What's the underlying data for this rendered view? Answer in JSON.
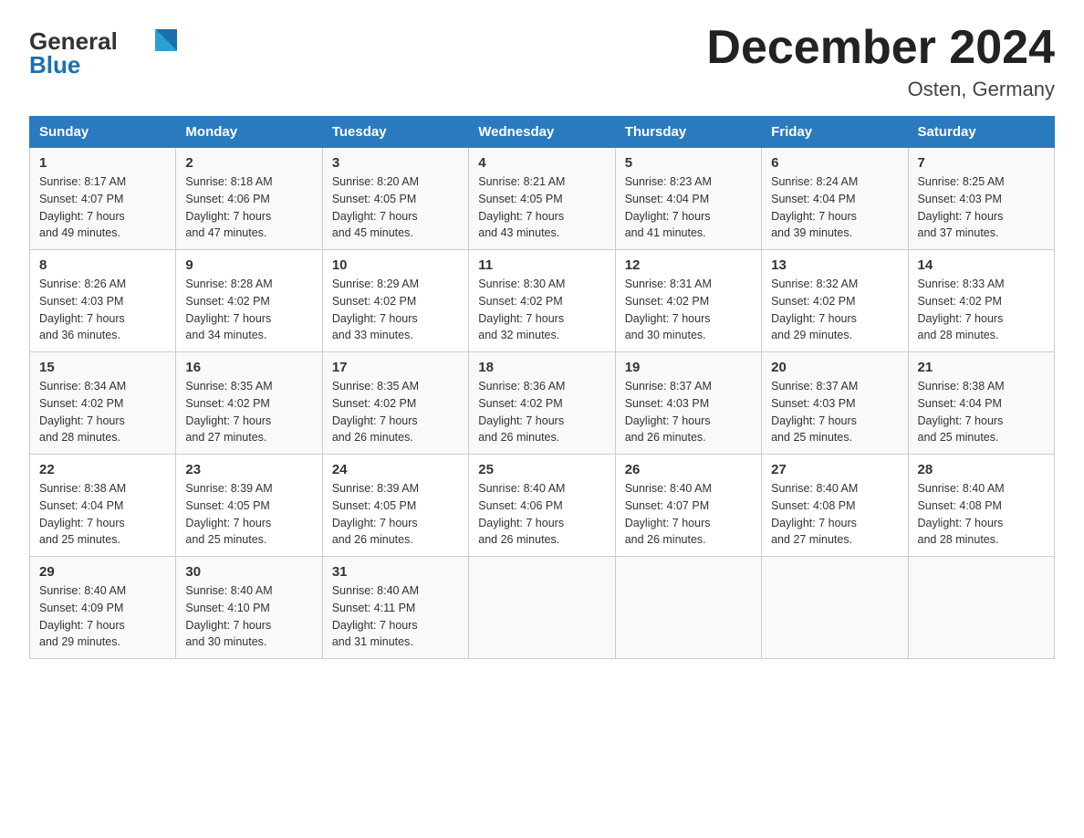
{
  "header": {
    "logo_line1": "General",
    "logo_line2": "Blue",
    "title": "December 2024",
    "subtitle": "Osten, Germany"
  },
  "weekdays": [
    "Sunday",
    "Monday",
    "Tuesday",
    "Wednesday",
    "Thursday",
    "Friday",
    "Saturday"
  ],
  "weeks": [
    [
      {
        "day": "1",
        "sunrise": "8:17 AM",
        "sunset": "4:07 PM",
        "daylight": "7 hours and 49 minutes."
      },
      {
        "day": "2",
        "sunrise": "8:18 AM",
        "sunset": "4:06 PM",
        "daylight": "7 hours and 47 minutes."
      },
      {
        "day": "3",
        "sunrise": "8:20 AM",
        "sunset": "4:05 PM",
        "daylight": "7 hours and 45 minutes."
      },
      {
        "day": "4",
        "sunrise": "8:21 AM",
        "sunset": "4:05 PM",
        "daylight": "7 hours and 43 minutes."
      },
      {
        "day": "5",
        "sunrise": "8:23 AM",
        "sunset": "4:04 PM",
        "daylight": "7 hours and 41 minutes."
      },
      {
        "day": "6",
        "sunrise": "8:24 AM",
        "sunset": "4:04 PM",
        "daylight": "7 hours and 39 minutes."
      },
      {
        "day": "7",
        "sunrise": "8:25 AM",
        "sunset": "4:03 PM",
        "daylight": "7 hours and 37 minutes."
      }
    ],
    [
      {
        "day": "8",
        "sunrise": "8:26 AM",
        "sunset": "4:03 PM",
        "daylight": "7 hours and 36 minutes."
      },
      {
        "day": "9",
        "sunrise": "8:28 AM",
        "sunset": "4:02 PM",
        "daylight": "7 hours and 34 minutes."
      },
      {
        "day": "10",
        "sunrise": "8:29 AM",
        "sunset": "4:02 PM",
        "daylight": "7 hours and 33 minutes."
      },
      {
        "day": "11",
        "sunrise": "8:30 AM",
        "sunset": "4:02 PM",
        "daylight": "7 hours and 32 minutes."
      },
      {
        "day": "12",
        "sunrise": "8:31 AM",
        "sunset": "4:02 PM",
        "daylight": "7 hours and 30 minutes."
      },
      {
        "day": "13",
        "sunrise": "8:32 AM",
        "sunset": "4:02 PM",
        "daylight": "7 hours and 29 minutes."
      },
      {
        "day": "14",
        "sunrise": "8:33 AM",
        "sunset": "4:02 PM",
        "daylight": "7 hours and 28 minutes."
      }
    ],
    [
      {
        "day": "15",
        "sunrise": "8:34 AM",
        "sunset": "4:02 PM",
        "daylight": "7 hours and 28 minutes."
      },
      {
        "day": "16",
        "sunrise": "8:35 AM",
        "sunset": "4:02 PM",
        "daylight": "7 hours and 27 minutes."
      },
      {
        "day": "17",
        "sunrise": "8:35 AM",
        "sunset": "4:02 PM",
        "daylight": "7 hours and 26 minutes."
      },
      {
        "day": "18",
        "sunrise": "8:36 AM",
        "sunset": "4:02 PM",
        "daylight": "7 hours and 26 minutes."
      },
      {
        "day": "19",
        "sunrise": "8:37 AM",
        "sunset": "4:03 PM",
        "daylight": "7 hours and 26 minutes."
      },
      {
        "day": "20",
        "sunrise": "8:37 AM",
        "sunset": "4:03 PM",
        "daylight": "7 hours and 25 minutes."
      },
      {
        "day": "21",
        "sunrise": "8:38 AM",
        "sunset": "4:04 PM",
        "daylight": "7 hours and 25 minutes."
      }
    ],
    [
      {
        "day": "22",
        "sunrise": "8:38 AM",
        "sunset": "4:04 PM",
        "daylight": "7 hours and 25 minutes."
      },
      {
        "day": "23",
        "sunrise": "8:39 AM",
        "sunset": "4:05 PM",
        "daylight": "7 hours and 25 minutes."
      },
      {
        "day": "24",
        "sunrise": "8:39 AM",
        "sunset": "4:05 PM",
        "daylight": "7 hours and 26 minutes."
      },
      {
        "day": "25",
        "sunrise": "8:40 AM",
        "sunset": "4:06 PM",
        "daylight": "7 hours and 26 minutes."
      },
      {
        "day": "26",
        "sunrise": "8:40 AM",
        "sunset": "4:07 PM",
        "daylight": "7 hours and 26 minutes."
      },
      {
        "day": "27",
        "sunrise": "8:40 AM",
        "sunset": "4:08 PM",
        "daylight": "7 hours and 27 minutes."
      },
      {
        "day": "28",
        "sunrise": "8:40 AM",
        "sunset": "4:08 PM",
        "daylight": "7 hours and 28 minutes."
      }
    ],
    [
      {
        "day": "29",
        "sunrise": "8:40 AM",
        "sunset": "4:09 PM",
        "daylight": "7 hours and 29 minutes."
      },
      {
        "day": "30",
        "sunrise": "8:40 AM",
        "sunset": "4:10 PM",
        "daylight": "7 hours and 30 minutes."
      },
      {
        "day": "31",
        "sunrise": "8:40 AM",
        "sunset": "4:11 PM",
        "daylight": "7 hours and 31 minutes."
      },
      null,
      null,
      null,
      null
    ]
  ],
  "labels": {
    "sunrise": "Sunrise:",
    "sunset": "Sunset:",
    "daylight": "Daylight:"
  }
}
